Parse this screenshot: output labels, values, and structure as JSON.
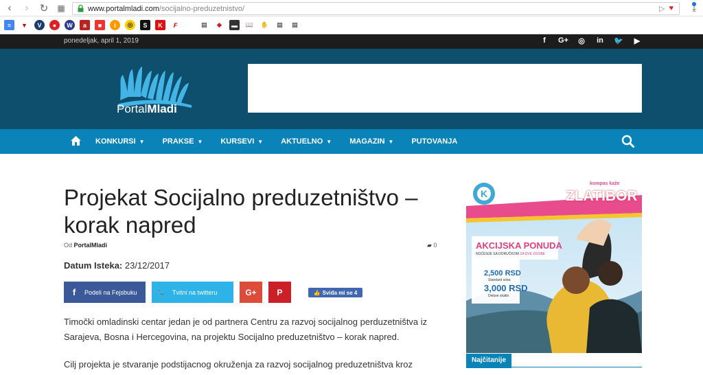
{
  "browser": {
    "url_host": "www.portalmladi.com",
    "url_path": "/socijalno-preduzetnistvo/"
  },
  "topbar": {
    "date": "ponedeljak, april 1, 2019"
  },
  "header": {
    "logo_part1": "Portal",
    "logo_part2": "Mladi"
  },
  "nav": {
    "items": [
      {
        "label": "KONKURSI"
      },
      {
        "label": "PRAKSE"
      },
      {
        "label": "KURSEVI"
      },
      {
        "label": "AKTUELNO"
      },
      {
        "label": "MAGAZIN"
      },
      {
        "label": "PUTOVANJA"
      }
    ]
  },
  "article": {
    "title": "Projekat Socijalno preduzetništvo – korak napred",
    "by_prefix": "Od",
    "author": "PortalMladi",
    "comment_count": "0",
    "deadline_label": "Datum Isteka:",
    "deadline_value": "23/12/2017",
    "share_facebook": "Podeli na Fejsbuku",
    "share_twitter": "Tvitni na twitteru",
    "like_label": "Sviđa mi se 4",
    "paragraph1": "Timočki omladinski centar jedan je od partnera Centru za razvoj socijalnog perduzetništva iz Sarajeva, Bosna i Hercegovina, na projektu Socijalno preduzetništvo – korak napred.",
    "paragraph2": "Cilj projekta je stvaranje podstijacnog okruženja za razvoj socijalnog preduzetništva kroz"
  },
  "ad": {
    "tagline": "kompas kaže",
    "destination": "ZLATIBOR",
    "headline": "AKCIJSKA PONUDA",
    "subline_a": "NOĆENJE SA DORUČKOM",
    "subline_b": "ZA DVE OSOBE",
    "price1": "2,500 RSD",
    "price1_note": "Standard soba",
    "price2": "3,000 RSD",
    "price2_note": "Deluxe studio"
  },
  "sidebar": {
    "tab_label": "Najčitanije"
  }
}
